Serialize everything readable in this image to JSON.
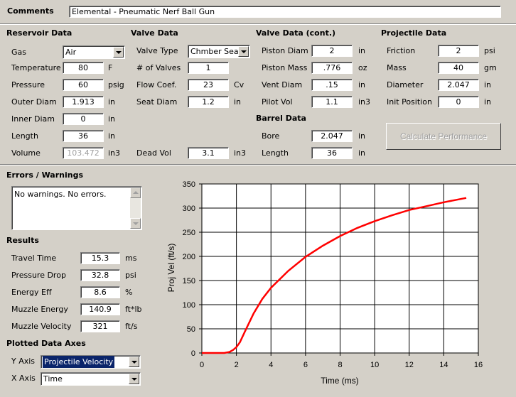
{
  "comments": {
    "label": "Comments",
    "value": "Elemental - Pneumatic Nerf Ball Gun"
  },
  "reservoir": {
    "title": "Reservoir Data",
    "gas_label": "Gas",
    "gas_value": "Air",
    "temp_label": "Temperature",
    "temp_value": "80",
    "temp_unit": "F",
    "pressure_label": "Pressure",
    "pressure_value": "60",
    "pressure_unit": "psig",
    "outer_label": "Outer Diam",
    "outer_value": "1.913",
    "outer_unit": "in",
    "inner_label": "Inner Diam",
    "inner_value": "0",
    "inner_unit": "in",
    "length_label": "Length",
    "length_value": "36",
    "length_unit": "in",
    "volume_label": "Volume",
    "volume_value": "103.472",
    "volume_unit": "in3"
  },
  "valve": {
    "title": "Valve Data",
    "type_label": "Valve Type",
    "type_value": "Chmber Seal",
    "num_label": "# of Valves",
    "num_value": "1",
    "flow_label": "Flow Coef.",
    "flow_value": "23",
    "flow_unit": "Cv",
    "seat_label": "Seat Diam",
    "seat_value": "1.2",
    "seat_unit": "in",
    "dead_label": "Dead Vol",
    "dead_value": "3.1",
    "dead_unit": "in3"
  },
  "valve2": {
    "title": "Valve Data (cont.)",
    "piston_label": "Piston Diam",
    "piston_value": "2",
    "piston_unit": "in",
    "mass_label": "Piston Mass",
    "mass_value": ".776",
    "mass_unit": "oz",
    "vent_label": "Vent Diam",
    "vent_value": ".15",
    "vent_unit": "in",
    "pilot_label": "Pilot Vol",
    "pilot_value": "1.1",
    "pilot_unit": "in3"
  },
  "barrel": {
    "title": "Barrel Data",
    "bore_label": "Bore",
    "bore_value": "2.047",
    "bore_unit": "in",
    "length_label": "Length",
    "length_value": "36",
    "length_unit": "in"
  },
  "projectile": {
    "title": "Projectile Data",
    "friction_label": "Friction",
    "friction_value": "2",
    "friction_unit": "psi",
    "mass_label": "Mass",
    "mass_value": "40",
    "mass_unit": "gm",
    "diam_label": "Diameter",
    "diam_value": "2.047",
    "diam_unit": "in",
    "init_label": "Init Position",
    "init_value": "0",
    "init_unit": "in"
  },
  "calculate_label": "Calculate Performance",
  "errors": {
    "title": "Errors / Warnings",
    "text": "No warnings.  No errors."
  },
  "results": {
    "title": "Results",
    "travel_label": "Travel Time",
    "travel_value": "15.3",
    "travel_unit": "ms",
    "drop_label": "Pressure Drop",
    "drop_value": "32.8",
    "drop_unit": "psi",
    "eff_label": "Energy Eff",
    "eff_value": "8.6",
    "eff_unit": "%",
    "energy_label": "Muzzle Energy",
    "energy_value": "140.9",
    "energy_unit": "ft*lb",
    "velocity_label": "Muzzle Velocity",
    "velocity_value": "321",
    "velocity_unit": "ft/s"
  },
  "axes": {
    "title": "Plotted Data Axes",
    "y_label": "Y Axis",
    "y_value": "Projectile Velocity",
    "x_label": "X Axis",
    "x_value": "Time"
  },
  "colors": {
    "curve": "#ff0000",
    "selection": "#0a246a"
  },
  "chart_data": {
    "type": "line",
    "xlabel": "Time (ms)",
    "ylabel": "Proj Vel (ft/s)",
    "xlim": [
      0,
      16
    ],
    "ylim": [
      0,
      350
    ],
    "xticks": [
      "0",
      "2",
      "4",
      "6",
      "8",
      "10",
      "12",
      "14",
      "16"
    ],
    "yticks": [
      "0",
      "50",
      "100",
      "150",
      "200",
      "250",
      "300",
      "350"
    ],
    "grid": true,
    "series": [
      {
        "x": [
          0,
          1.3,
          1.6,
          1.8,
          2.0,
          2.2,
          2.5,
          3.0,
          3.5,
          4.0,
          5.0,
          6.0,
          7.0,
          8.0,
          9.0,
          10.0,
          11.0,
          12.0,
          13.0,
          14.0,
          15.3
        ],
        "y": [
          0,
          0,
          2,
          6,
          12,
          22,
          45,
          82,
          112,
          135,
          170,
          199,
          222,
          242,
          259,
          273,
          285,
          296,
          304,
          312,
          321
        ]
      }
    ]
  }
}
